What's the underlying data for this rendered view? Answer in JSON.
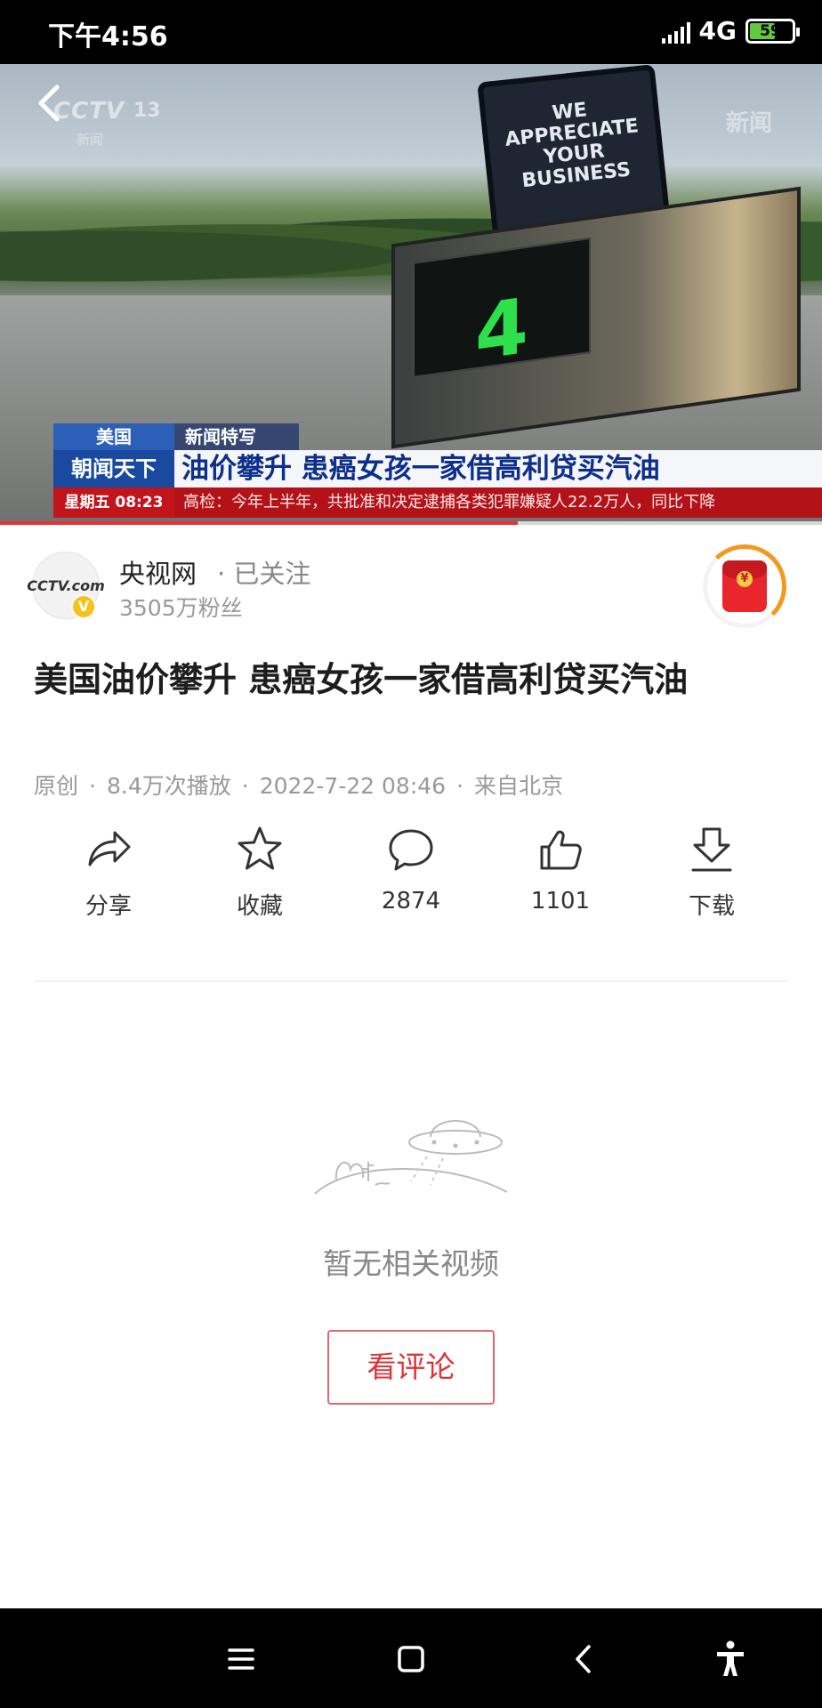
{
  "status_bar": {
    "time": "下午4:56",
    "network": "4G",
    "battery": "59"
  },
  "video": {
    "channel_logo": "CCTV",
    "channel_number": "13",
    "channel_sub": "新闻",
    "watermark": "新闻",
    "sign_text": "WE APPRECIATE YOUR BUSINESS",
    "pump_number": "4",
    "lower_third": {
      "country": "美国",
      "program": "朝闻天下",
      "tag": "新闻特写",
      "headline": "油价攀升 患癌女孩一家借高利贷买汽油",
      "day_time": "星期五  08:23",
      "ticker": "高检：今年上半年，共批准和决定逮捕各类犯罪嫌疑人22.2万人，同比下降"
    },
    "progress": 0.63
  },
  "author": {
    "name": "央视网",
    "follow_status": "· 已关注",
    "fans": "3505万粉丝",
    "avatar_text": "CCTV.com"
  },
  "article": {
    "title": "美国油价攀升 患癌女孩一家借高利贷买汽油",
    "source": "原创",
    "plays": "8.4万次播放",
    "datetime": "2022-7-22 08:46",
    "location": "来自北京"
  },
  "actions": [
    {
      "label": "分享",
      "icon": "share-icon"
    },
    {
      "label": "收藏",
      "icon": "star-icon"
    },
    {
      "label": "2874",
      "icon": "comment-icon"
    },
    {
      "label": "1101",
      "icon": "thumbs-up-icon"
    },
    {
      "label": "下载",
      "icon": "download-icon"
    }
  ],
  "empty_state": {
    "text": "暂无相关视频",
    "button": "看评论"
  },
  "colors": {
    "accent_red": "#e0333a",
    "progress": "#e8303a",
    "badge_yellow": "#f5c21b"
  }
}
